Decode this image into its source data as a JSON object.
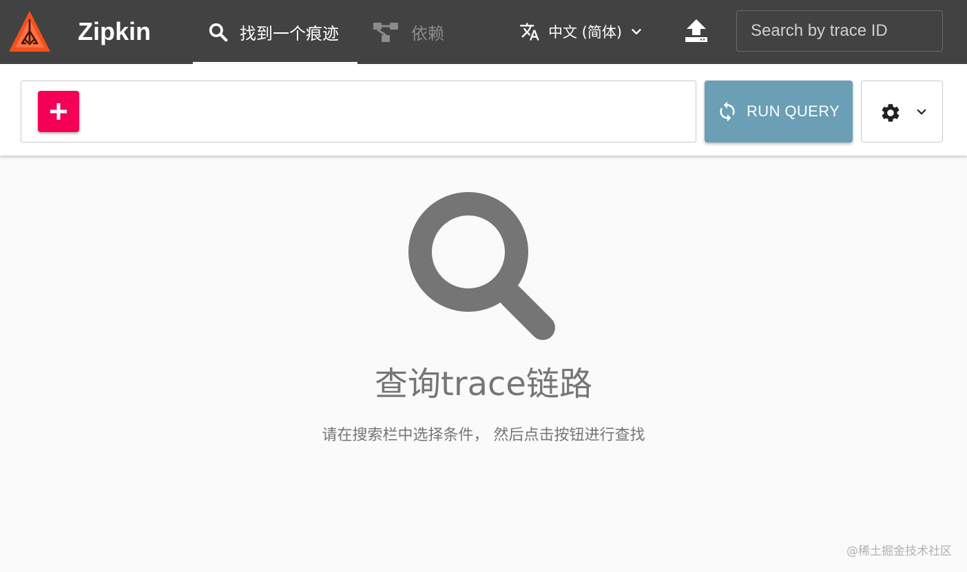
{
  "app": {
    "name": "Zipkin",
    "brand_color": "#ff6e40"
  },
  "nav": {
    "tabs": [
      {
        "label": "找到一个痕迹",
        "icon": "search-icon",
        "active": true
      },
      {
        "label": "依赖",
        "icon": "dependencies-icon",
        "active": false
      }
    ]
  },
  "language": {
    "label": "中文 (简体)",
    "icon": "translate-icon"
  },
  "upload": {
    "icon": "upload-icon"
  },
  "trace_search": {
    "placeholder": "Search by trace ID",
    "value": ""
  },
  "query": {
    "add_icon": "plus-icon",
    "run_label": "RUN QUERY",
    "run_icon": "sync-icon",
    "settings_icon": "gear-icon"
  },
  "empty_state": {
    "icon": "search-icon",
    "title": "查询trace链路",
    "subtitle": "请在搜索栏中选择条件， 然后点击按钮进行查找"
  },
  "watermark": "@稀土掘金技术社区",
  "colors": {
    "appbar": "#424242",
    "add_button": "#f50057",
    "run_button": "#6a9fb5",
    "empty_state_text": "#757575"
  }
}
